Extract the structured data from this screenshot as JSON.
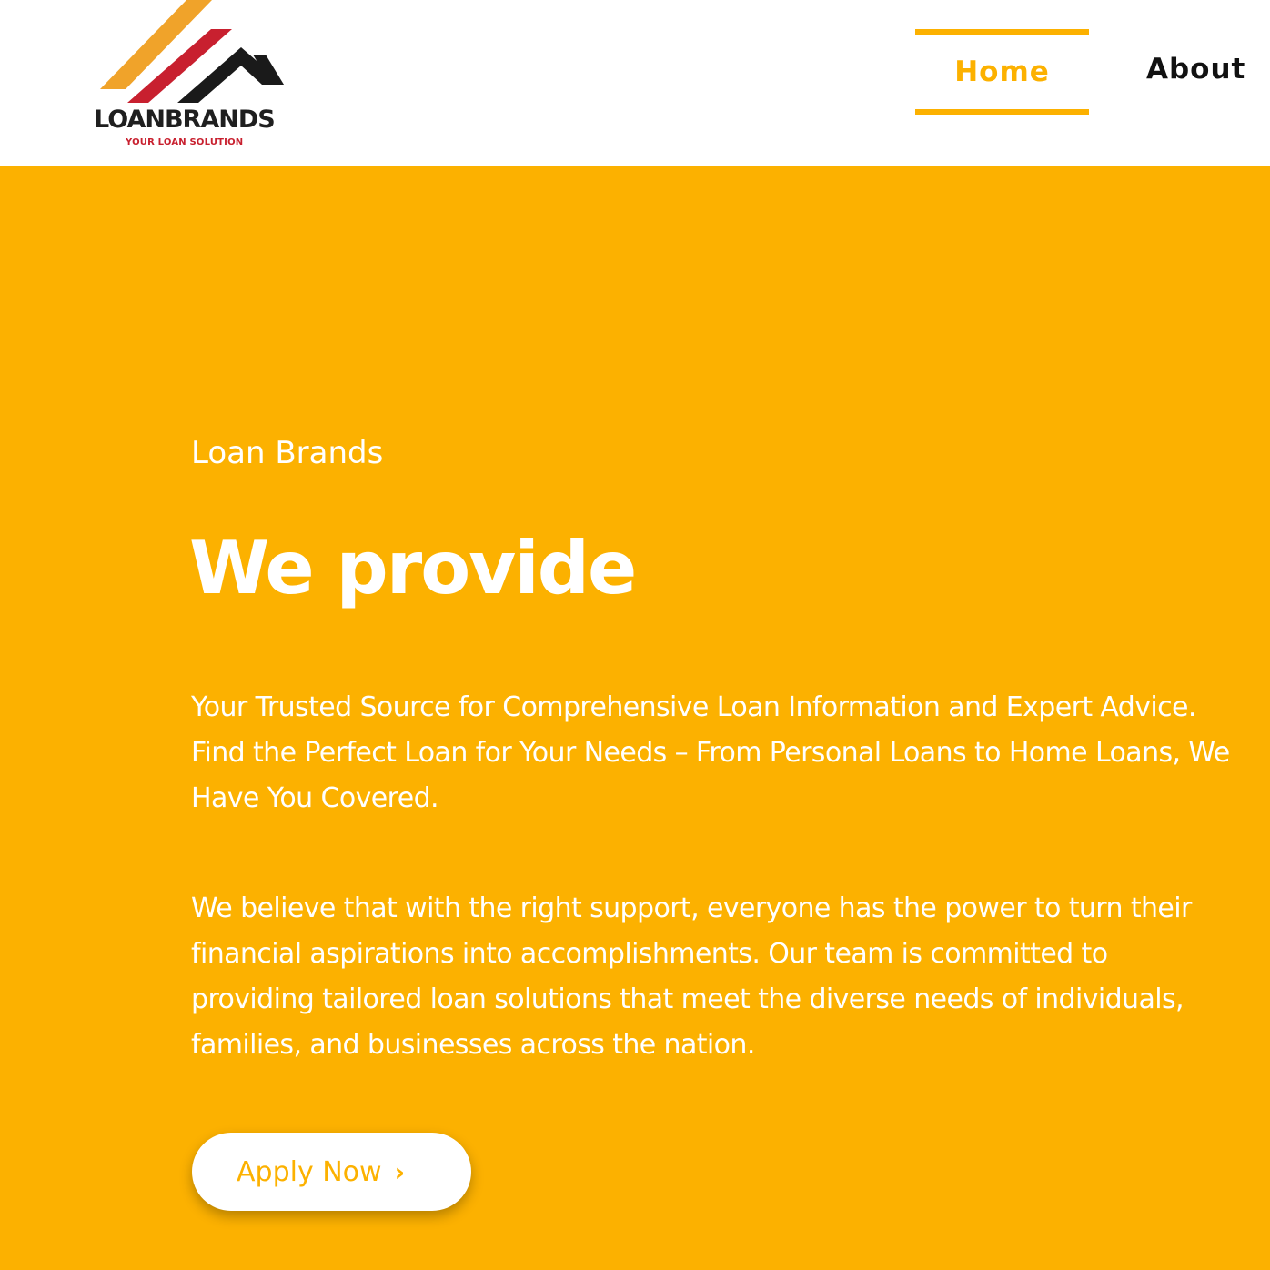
{
  "header": {
    "logo": {
      "name": "LOANBRANDS",
      "tagline": "YOUR LOAN SOLUTION",
      "colors": {
        "orange": "#f0a32a",
        "red": "#c8202f",
        "black": "#1a1a1a"
      }
    },
    "nav": {
      "home": "Home",
      "about": "About"
    }
  },
  "hero": {
    "eyebrow": "Loan Brands",
    "headline": "We provide",
    "paragraph1": "Your Trusted Source for Comprehensive Loan Information and Expert Advice. Find the Perfect Loan for Your Needs – From Personal Loans to Home Loans, We Have You Covered.",
    "paragraph2": "We believe that with the right support, everyone has the power to turn their financial aspirations into accomplishments. Our team is committed to providing tailored loan solutions that meet the diverse needs of individuals, families, and businesses across the nation.",
    "cta": {
      "label": "Apply Now",
      "icon": "chevron-right-icon"
    }
  },
  "theme": {
    "accent": "#fcb100",
    "header_bg": "#ffffff",
    "text_on_accent": "#ffffff",
    "nav_text": "#111111"
  }
}
